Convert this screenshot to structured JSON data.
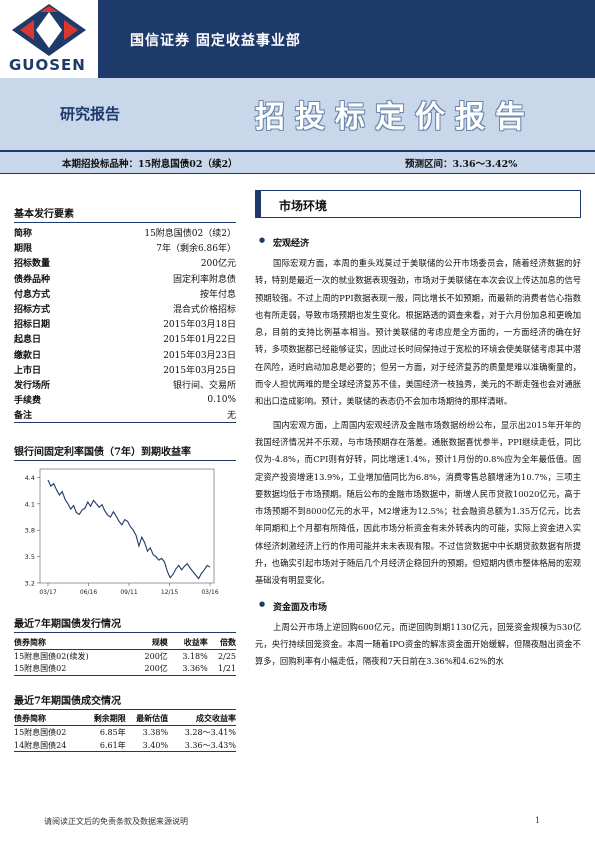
{
  "header": {
    "logo_text": "GUOSEN",
    "firm_name": "国信证券 固定收益事业部",
    "report_type": "研究报告",
    "report_title": "招投标定价报告",
    "bond_label": "本期招投标品种：15附息国债02（续2）",
    "range_label": "预测区间：3.36～3.42%"
  },
  "issue_terms": {
    "title": "基本发行要素",
    "rows": [
      {
        "k": "简称",
        "v": "15附息国债02（续2）"
      },
      {
        "k": "期限",
        "v": "7年（剩余6.86年）"
      },
      {
        "k": "招标数量",
        "v": "200亿元"
      },
      {
        "k": "债券品种",
        "v": "固定利率附息债"
      },
      {
        "k": "付息方式",
        "v": "按年付息"
      },
      {
        "k": "招标方式",
        "v": "混合式价格招标"
      },
      {
        "k": "招标日期",
        "v": "2015年03月18日"
      },
      {
        "k": "起息日",
        "v": "2015年01月22日"
      },
      {
        "k": "缴款日",
        "v": "2015年03月23日"
      },
      {
        "k": "上市日",
        "v": "2015年03月25日"
      },
      {
        "k": "发行场所",
        "v": "银行间、交易所"
      },
      {
        "k": "手续费",
        "v": "0.10%"
      },
      {
        "k": "备注",
        "v": "无"
      }
    ]
  },
  "chart_data": {
    "type": "line",
    "title": "银行间固定利率国债（7年）到期收益率",
    "xlabel": "",
    "ylabel": "",
    "x_ticks": [
      "03/17",
      "06/16",
      "09/11",
      "12/15",
      "03/16"
    ],
    "y_ticks": [
      3.2,
      3.5,
      3.8,
      4.1,
      4.4
    ],
    "ylim": [
      3.2,
      4.45
    ],
    "grid": false,
    "series": [
      {
        "values": [
          4.37,
          4.3,
          4.33,
          4.26,
          4.2,
          4.24,
          4.15,
          4.1,
          4.04,
          4.08,
          4.0,
          3.98,
          4.03,
          4.05,
          4.12,
          4.07,
          4.14,
          4.1,
          4.06,
          4.09,
          4.02,
          3.97,
          3.95,
          4.01,
          3.96,
          3.9,
          3.86,
          3.92,
          3.9,
          3.84,
          3.8,
          3.74,
          3.62,
          3.72,
          3.66,
          3.56,
          3.6,
          3.52,
          3.5,
          3.46,
          3.48,
          3.44,
          3.33,
          3.26,
          3.3,
          3.36,
          3.4,
          3.35,
          3.39,
          3.42,
          3.37,
          3.33,
          3.29,
          3.25,
          3.31,
          3.35,
          3.4,
          3.38
        ]
      }
    ]
  },
  "recent_issues": {
    "title": "最近7年期国债发行情况",
    "headers": [
      "债券简称",
      "规模",
      "收益率",
      "倍数"
    ],
    "rows": [
      [
        "15附息国债02(续发)",
        "200亿",
        "3.18%",
        "2/25"
      ],
      [
        "15附息国债02",
        "200亿",
        "3.36%",
        "1/21"
      ]
    ]
  },
  "recent_trades": {
    "title": "最近7年期国债成交情况",
    "headers": [
      "债券简称",
      "剩余期限",
      "最新估值",
      "成交收益率"
    ],
    "rows": [
      [
        "15附息国债02",
        "6.85年",
        "3.38%",
        "3.28～3.41%"
      ],
      [
        "14附息国债24",
        "6.61年",
        "3.40%",
        "3.36～3.43%"
      ]
    ]
  },
  "main": {
    "section_title": "市场环境",
    "macro_title": "宏观经济",
    "macro_p1": "国际宏观方面，本周的重头戏莫过于美联储的公开市场委员会，随着经济数据的好转，特别是最近一次的就业数据表现强劲，市场对于美联储在本次会议上传达加息的信号预期较强。不过上周的PPI数据表现一般，同比增长不如预期，而最新的消费者信心指数也有所走弱，导致市场预期也发生变化。根据路透的调查来看，对于六月份加息和更晚加息，目前的支持比例基本相当。预计美联储的考虑应是全方面的，一方面经济的确在好转，多项数据都已经能够证实，因此过长时间保持过于宽松的环境会使美联储考虑其中潜在风险，适时启动加息是必要的；但另一方面，对于经济复苏的质量是难以准确衡量的，而令人担忧两难的是全球经济复苏不佳，美国经济一枝独秀，美元的不断走强也会对通胀和出口造成影响。预计，美联储的表态仍不会加市场期待的那样清晰。",
    "macro_p2": "国内宏观方面，上周国内宏观经济及金融市场数据纷纷公布，显示出2015年开年的我国经济情况并不乐观，与市场预期存在落差。通胀数据喜忧参半，PPI继续走低，同比仅为-4.8%，而CPI则有好转，同比增速1.4%，预计1月份的0.8%应为全年最低值。固定资产投资增速13.9%，工业增加值同比为6.8%，消费零售总额增速为10.7%，三项主要数据均低于市场预期。随后公布的金融市场数据中，新增人民币贷款10020亿元，高于市场预期不到8000亿元的水平，M2增速为12.5%；社会融资总额为1.35万亿元，比去年同期和上个月都有所降低，因此市场分析资金有未外转表内的可能，实际上资金进入实体经济刺激经济上行的作用可能并未未表现有限。不过信贷数据中中长期贷款数据有所提升，也确实引起市场对于随后几个月经济企稳回升的预期，但短期内债市整体格局的宏观基础没有明显变化。",
    "funds_title": "资金面及市场",
    "funds_p1": "上周公开市场上逆回购600亿元，而逆回购到期1130亿元，回笼资金规模为530亿元，央行持续回笼资金。本周一随着IPO资金的解冻资金面开始缓解，但隔夜融出资金不算多，回购利率有小幅走低，隔夜和7天日前在3.36%和4.62%的水"
  },
  "footer": {
    "disclaimer": "请阅读正文后的免责条款及数据来源说明",
    "page": "1"
  }
}
